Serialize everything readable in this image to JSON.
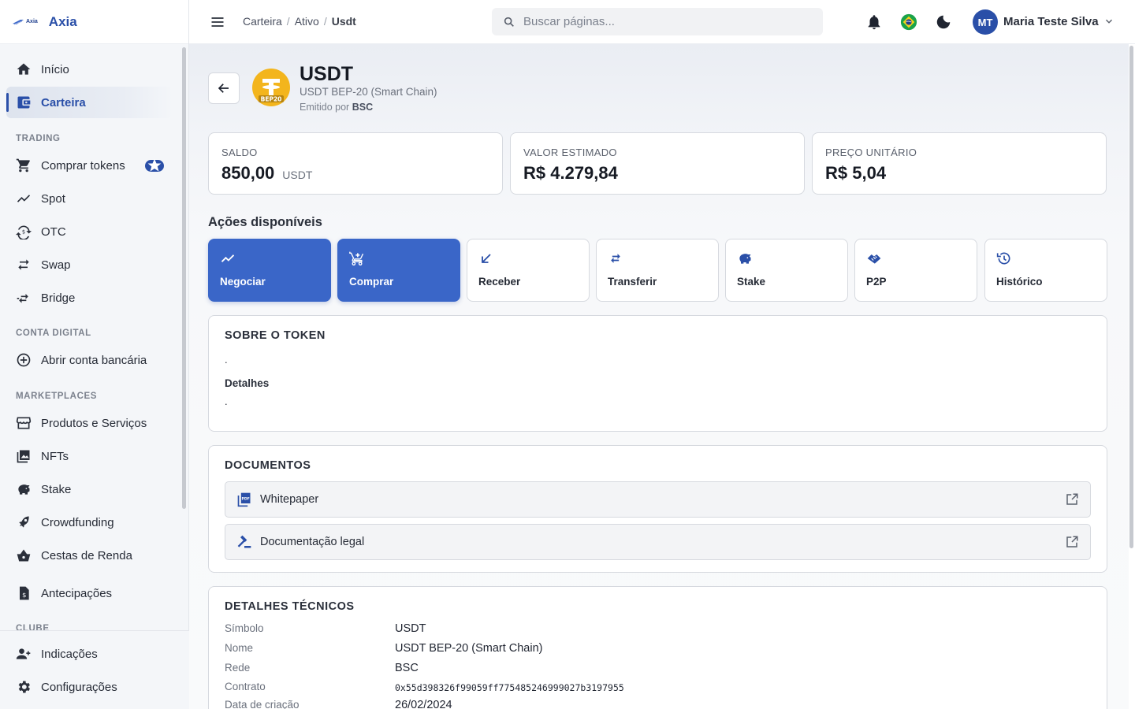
{
  "brand": {
    "mini": "Axia",
    "name": "Axia"
  },
  "sidebar": {
    "items_top": [
      {
        "label": "Início",
        "icon": "home-icon"
      },
      {
        "label": "Carteira",
        "icon": "wallet-icon",
        "active": true
      }
    ],
    "sections": [
      {
        "title": "TRADING",
        "items": [
          {
            "label": "Comprar tokens",
            "icon": "cart-icon",
            "badge": "star"
          },
          {
            "label": "Spot",
            "icon": "trend-icon"
          },
          {
            "label": "OTC",
            "icon": "currency-exchange-icon"
          },
          {
            "label": "Swap",
            "icon": "swap-icon"
          },
          {
            "label": "Bridge",
            "icon": "bridge-icon"
          }
        ]
      },
      {
        "title": "CONTA DIGITAL",
        "items": [
          {
            "label": "Abrir conta bancária",
            "icon": "plus-circle-icon"
          }
        ]
      },
      {
        "title": "MARKETPLACES",
        "items": [
          {
            "label": "Produtos e Serviços",
            "icon": "store-icon"
          },
          {
            "label": "NFTs",
            "icon": "image-icon"
          },
          {
            "label": "Stake",
            "icon": "piggy-bank-icon"
          },
          {
            "label": "Crowdfunding",
            "icon": "rocket-icon"
          },
          {
            "label": "Cestas de Renda",
            "icon": "basket-icon"
          },
          {
            "label": "Antecipações",
            "icon": "receipt-icon"
          }
        ]
      },
      {
        "title": "CLUBE",
        "items": []
      }
    ],
    "bottom": [
      {
        "label": "Indicações",
        "icon": "person-add-icon"
      },
      {
        "label": "Configurações",
        "icon": "gear-icon"
      }
    ]
  },
  "topbar": {
    "breadcrumb": [
      "Carteira",
      "Ativo",
      "Usdt"
    ],
    "search_placeholder": "Buscar páginas...",
    "user": {
      "initials": "MT",
      "name": "Maria Teste Silva"
    }
  },
  "token": {
    "symbol": "USDT",
    "full_name": "USDT BEP-20 (Smart Chain)",
    "issuer_prefix": "Emitido por",
    "issuer": "BSC",
    "logo_tag": "BEP20",
    "logo_color": "#f3b51d"
  },
  "stats": [
    {
      "label": "SALDO",
      "value": "850,00",
      "unit": "USDT"
    },
    {
      "label": "VALOR ESTIMADO",
      "value": "R$ 4.279,84",
      "unit": ""
    },
    {
      "label": "PREÇO UNITÁRIO",
      "value": "R$ 5,04",
      "unit": ""
    }
  ],
  "actions": {
    "title": "Ações disponíveis",
    "items": [
      {
        "label": "Negociar",
        "icon": "trend-icon",
        "primary": true
      },
      {
        "label": "Comprar",
        "icon": "cart-plus-icon",
        "primary": true
      },
      {
        "label": "Receber",
        "icon": "arrow-down-left-icon",
        "primary": false
      },
      {
        "label": "Transferir",
        "icon": "swap-icon",
        "primary": false
      },
      {
        "label": "Stake",
        "icon": "piggy-bank-icon",
        "primary": false
      },
      {
        "label": "P2P",
        "icon": "handshake-icon",
        "primary": false
      },
      {
        "label": "Histórico",
        "icon": "history-icon",
        "primary": false
      }
    ]
  },
  "about": {
    "title": "SOBRE O TOKEN",
    "description": ".",
    "details_title": "Detalhes",
    "details": "."
  },
  "documents": {
    "title": "DOCUMENTOS",
    "items": [
      {
        "label": "Whitepaper",
        "icon": "pdf-icon"
      },
      {
        "label": "Documentação legal",
        "icon": "gavel-icon"
      }
    ]
  },
  "technical": {
    "title": "DETALHES TÉCNICOS",
    "rows": [
      {
        "key": "Símbolo",
        "value": "USDT"
      },
      {
        "key": "Nome",
        "value": "USDT BEP-20 (Smart Chain)"
      },
      {
        "key": "Rede",
        "value": "BSC"
      },
      {
        "key": "Contrato",
        "value": "0x55d398326f99059ff775485246999027b3197955"
      },
      {
        "key": "Data de criação",
        "value": "26/02/2024"
      }
    ]
  },
  "colors": {
    "accent": "#2a4fa8",
    "action_primary": "#3a66c8"
  }
}
